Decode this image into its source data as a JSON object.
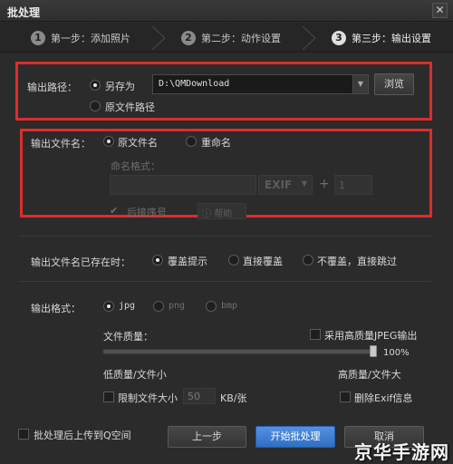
{
  "window": {
    "title": "批处理",
    "close_glyph": "✕"
  },
  "steps": [
    {
      "num": "1",
      "label": "第一步：添加照片"
    },
    {
      "num": "2",
      "label": "第二步：动作设置"
    },
    {
      "num": "3",
      "label": "第三步：输出设置"
    }
  ],
  "output_path": {
    "label": "输出路径：",
    "save_as": "另存为",
    "original_path": "原文件路径",
    "path_value": "D:\\QMDownload",
    "browse": "浏览"
  },
  "output_name": {
    "label": "输出文件名：",
    "original_name": "原文件名",
    "rename": "重命名",
    "format_label": "命名格式：",
    "exif": "EXIF",
    "plus": "+",
    "start_number": "1",
    "append_index": "后接序号",
    "help": "帮助"
  },
  "exists": {
    "label": "输出文件名已存在时：",
    "opt1": "覆盖提示",
    "opt2": "直接覆盖",
    "opt3": "不覆盖，直接跳过"
  },
  "format": {
    "label": "输出格式：",
    "jpg": "jpg",
    "png": "png",
    "bmp": "bmp",
    "quality_label": "文件质量：",
    "high_quality_jpeg": "采用高质量JPEG输出",
    "quality_percent": "100%",
    "quality_value": 1.0,
    "low_label": "低质量/文件小",
    "high_label": "高质量/文件大",
    "limit_size": "限制文件大小",
    "size_value": "50",
    "size_unit": "KB/张",
    "remove_exif": "删除Exif信息"
  },
  "footer": {
    "upload_after": "批处理后上传到Q空间",
    "prev": "上一步",
    "start": "开始批处理",
    "cancel": "取消"
  },
  "watermark": "京华手游网",
  "colors": {
    "highlight_box": "#dd2c2c",
    "primary_button": "#3f7fd2"
  }
}
